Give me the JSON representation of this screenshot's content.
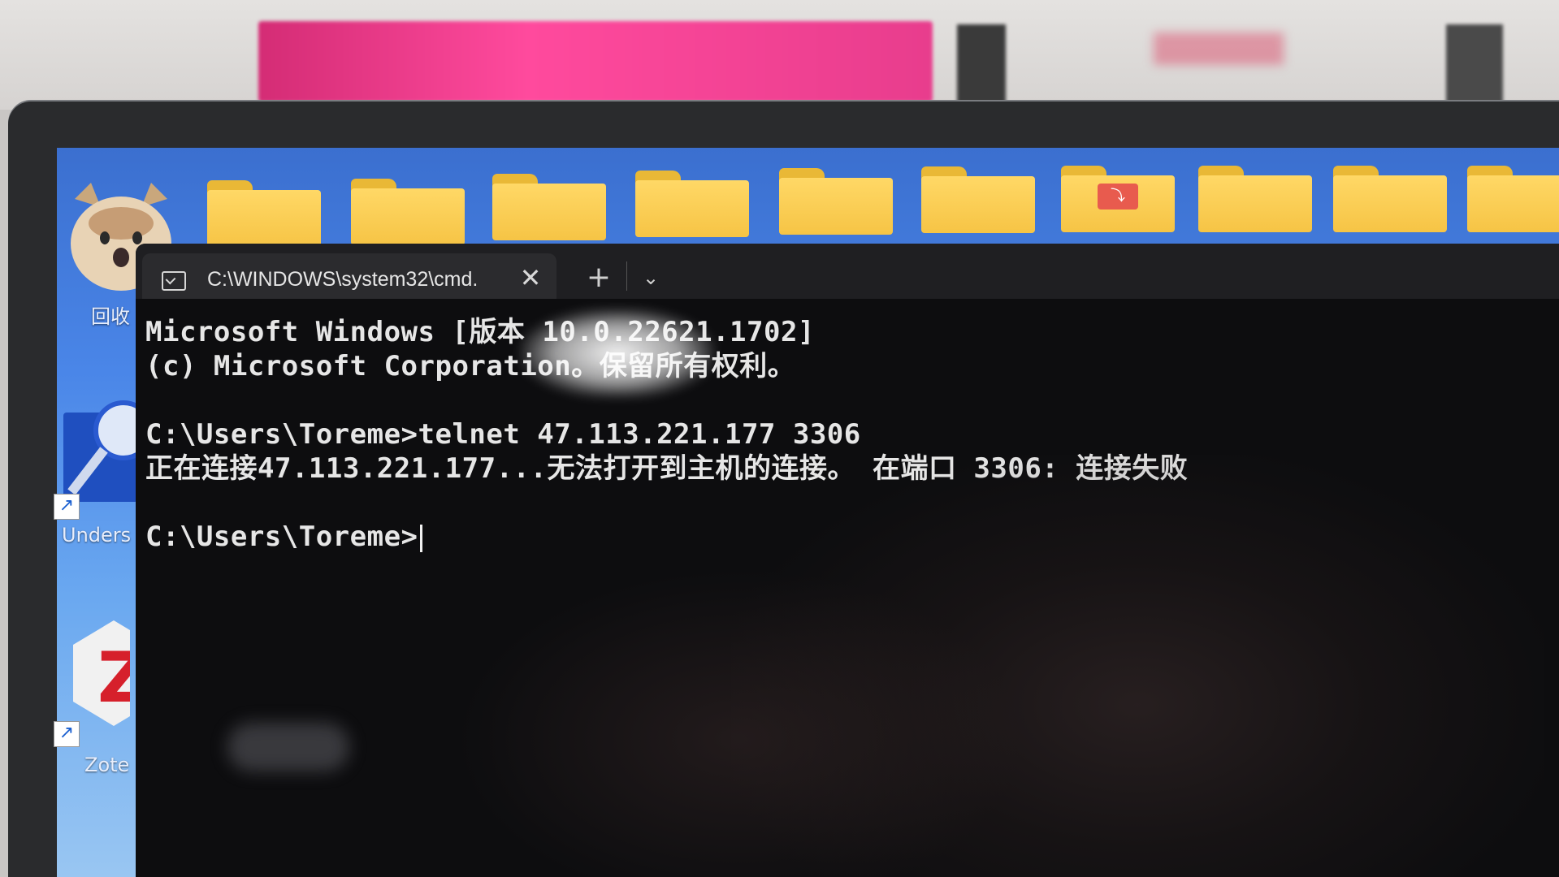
{
  "desktop": {
    "icons": [
      {
        "label": "回收",
        "icon": "recycle-bin-cat-icon"
      },
      {
        "label": "Unders",
        "icon": "magnifier-app-icon"
      },
      {
        "label": "Zote",
        "icon": "zotero-icon"
      }
    ],
    "folders": [
      "folder-icon",
      "folder-icon",
      "folder-icon",
      "folder-icon",
      "folder-icon",
      "folder-icon",
      "pdf-folder-icon",
      "folder-icon",
      "folder-icon",
      "folder-icon"
    ]
  },
  "terminal": {
    "tab_title": "C:\\WINDOWS\\system32\\cmd.",
    "close_glyph": "✕",
    "new_tab_glyph": "+",
    "dropdown_glyph": "⌄",
    "lines": [
      "Microsoft Windows [版本 10.0.22621.1702]",
      "(c) Microsoft Corporation。保留所有权利。",
      "",
      "C:\\Users\\Toreme>telnet 47.113.221.177 3306",
      "正在连接47.113.221.177...无法打开到主机的连接。 在端口 3306: 连接失败",
      "",
      "C:\\Users\\Toreme>"
    ]
  },
  "colors": {
    "terminal_bg": "#0d0d0f",
    "text": "#e6e6e6",
    "wallpaper": "#4a86e8",
    "folder": "#f6c445"
  }
}
